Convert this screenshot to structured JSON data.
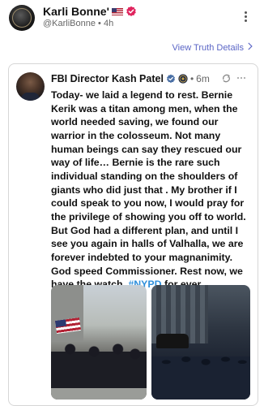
{
  "post": {
    "author_name": "Karli Bonne'",
    "handle": "@KarliBonne",
    "time": "4h",
    "view_details_label": "View Truth Details",
    "icons": {
      "flag": "us-flag-icon",
      "verified": "verified-icon",
      "more": "more-icon",
      "chevron": "chevron-right-icon"
    }
  },
  "quoted_post": {
    "author_name": "FBI Director Kash Patel",
    "time": "6m",
    "body_text": "Today- we laid a legend to rest. Bernie Kerik was a titan among men, when the world needed saving, we found our warrior in the colosseum. Not many human beings can say they rescued our way of life… Bernie is the rare such individual standing on the shoulders of giants who did just that . My brother if I could speak to you now, I would pray for the privilege of showing you off to world. But God had a different plan, and until I see you again in  halls of Valhalla, we are forever indebted to your magnanimity. God speed Commissioner. Rest now, we have the watch.",
    "hashtag": "#NYPD",
    "body_tail": "for ever",
    "icons": {
      "verified": "verified-icon",
      "org": "fbi-seal-icon",
      "repost": "repost-icon",
      "more": "more-icon"
    }
  },
  "colors": {
    "accent": "#5b66c6",
    "hashtag": "#2f8fdb",
    "verified_badge": "#e0245e",
    "verified_quoted": "#4a6fa5"
  }
}
